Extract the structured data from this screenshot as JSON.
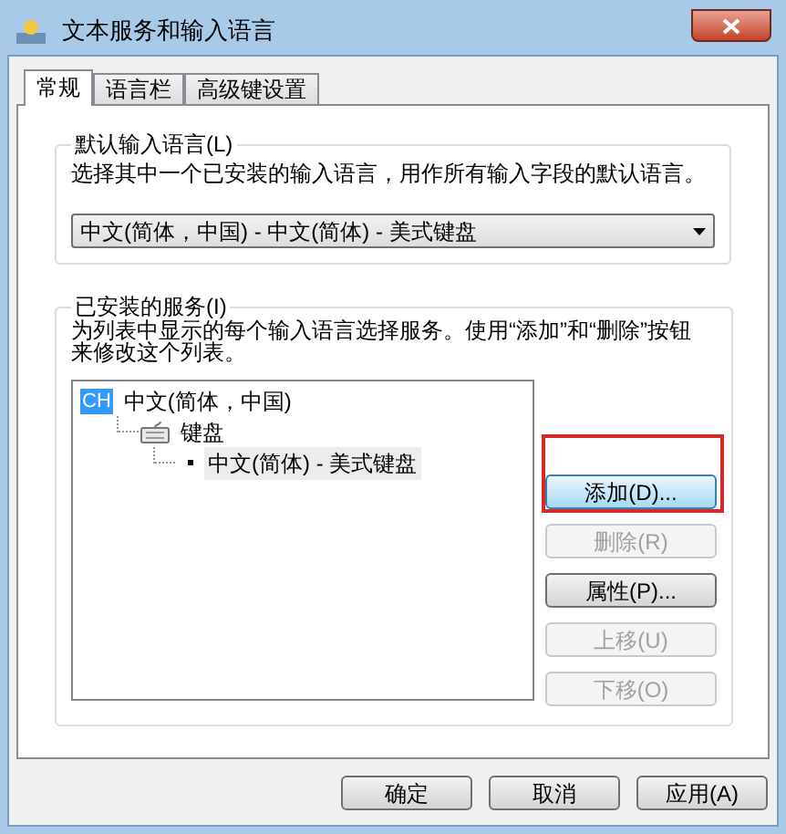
{
  "window": {
    "title": "文本服务和输入语言"
  },
  "tabs": [
    {
      "label": "常规",
      "selected": true
    },
    {
      "label": "语言栏",
      "selected": false
    },
    {
      "label": "高级键设置",
      "selected": false
    }
  ],
  "default_language": {
    "legend": "默认输入语言(L)",
    "description": "选择其中一个已安装的输入语言，用作所有输入字段的默认语言。",
    "value": "中文(简体，中国) - 中文(简体) - 美式键盘"
  },
  "installed_services": {
    "legend": "已安装的服务(I)",
    "description": "为列表中显示的每个输入语言选择服务。使用“添加”和“删除”按钮来修改这个列表。",
    "tree": [
      {
        "kind": "language",
        "badge": "CH",
        "label": "中文(简体，中国)",
        "selected": false,
        "children": [
          {
            "kind": "category",
            "label": "键盘",
            "selected": false,
            "children": [
              {
                "kind": "service",
                "label": "中文(简体) - 美式键盘",
                "selected": true
              }
            ]
          }
        ]
      }
    ],
    "buttons": [
      {
        "label": "添加(D)...",
        "disabled": false,
        "highlighted": true
      },
      {
        "label": "删除(R)",
        "disabled": true,
        "highlighted": false
      },
      {
        "label": "属性(P)...",
        "disabled": false,
        "highlighted": false
      },
      {
        "label": "上移(U)",
        "disabled": true,
        "highlighted": false
      },
      {
        "label": "下移(O)",
        "disabled": true,
        "highlighted": false
      }
    ]
  },
  "footer_buttons": [
    {
      "label": "确定"
    },
    {
      "label": "取消"
    },
    {
      "label": "应用(A)"
    }
  ]
}
